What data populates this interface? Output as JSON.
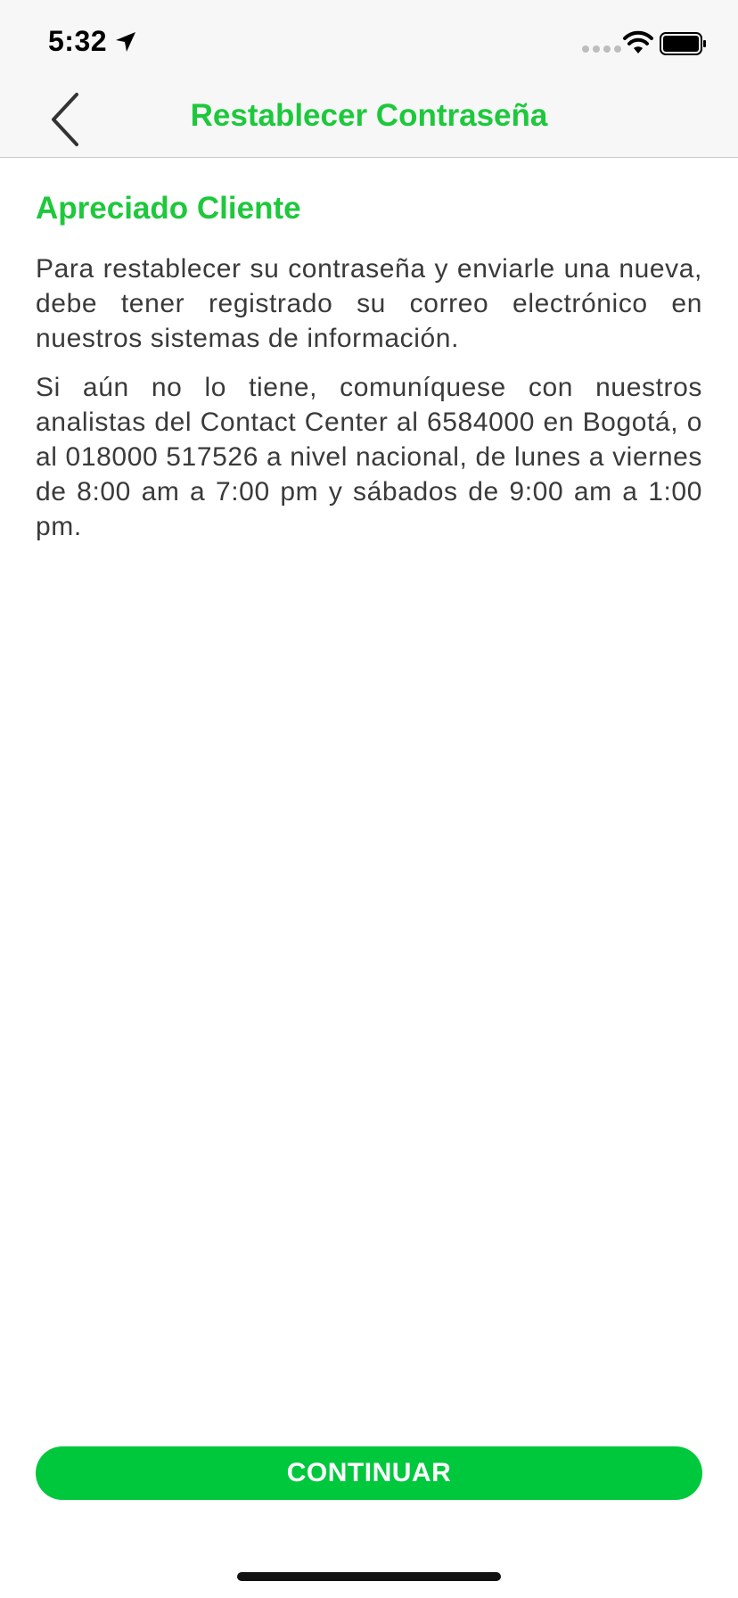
{
  "status_bar": {
    "time": "5:32",
    "icons": [
      "location-arrow-icon",
      "signal-dots-icon",
      "wifi-icon",
      "battery-icon"
    ]
  },
  "nav": {
    "title": "Restablecer Contraseña",
    "back_icon": "chevron-left-icon"
  },
  "content": {
    "greeting": "Apreciado Cliente",
    "paragraph_1": "Para restablecer su contraseña y enviarle una nueva, debe tener registrado su correo electrónico en nuestros sistemas de información.",
    "paragraph_2": "Si aún no lo tiene, comuníquese con nuestros analistas del Contact Center al 6584000 en Bogotá, o al 018000 517526 a nivel nacional, de lunes a viernes de 8:00 am a 7:00 pm y sábados de 9:00 am a 1:00 pm."
  },
  "actions": {
    "continue_label": "CONTINUAR"
  },
  "colors": {
    "accent": "#1ec83c",
    "button": "#00c83c",
    "text": "#3a3a3a",
    "bar_background": "#f7f7f7"
  }
}
